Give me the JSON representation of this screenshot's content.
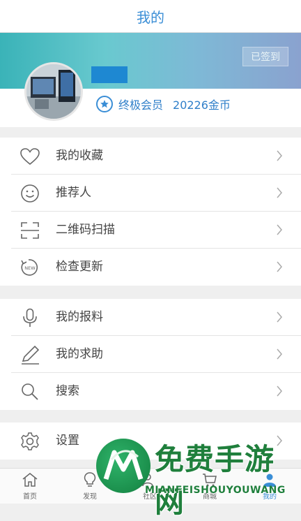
{
  "header": {
    "title": "我的"
  },
  "profile": {
    "signed_label": "已签到",
    "member_level": "终极会员",
    "coins": "20226金币"
  },
  "menu_groups": [
    {
      "items": [
        {
          "label": "我的收藏",
          "icon": "heart-icon"
        },
        {
          "label": "推荐人",
          "icon": "smiley-icon"
        },
        {
          "label": "二维码扫描",
          "icon": "qr-scan-icon"
        },
        {
          "label": "检查更新",
          "icon": "update-new-icon",
          "icon_text": "NEW"
        }
      ]
    },
    {
      "items": [
        {
          "label": "我的报料",
          "icon": "microphone-icon"
        },
        {
          "label": "我的求助",
          "icon": "pencil-icon"
        },
        {
          "label": "搜索",
          "icon": "search-icon"
        }
      ]
    },
    {
      "items": [
        {
          "label": "设置",
          "icon": "gear-icon"
        }
      ]
    }
  ],
  "tabbar": [
    {
      "label": "首页",
      "icon": "home-icon"
    },
    {
      "label": "发现",
      "icon": "bulb-icon"
    },
    {
      "label": "社区",
      "icon": "community-icon"
    },
    {
      "label": "商城",
      "icon": "cart-icon"
    },
    {
      "label": "我的",
      "icon": "person-icon"
    }
  ],
  "watermark": {
    "title": "免费手游网",
    "subtitle": "MIANFEISHOUYOUWANG"
  },
  "colors": {
    "accent": "#3a8ed6",
    "watermark": "#1f7f3c"
  }
}
